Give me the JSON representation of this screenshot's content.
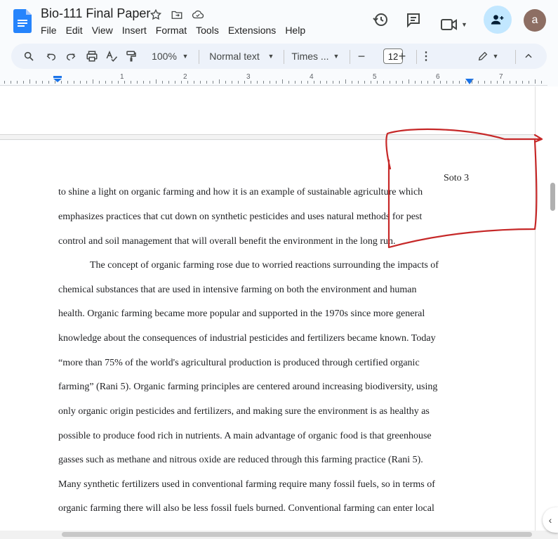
{
  "doc": {
    "title": "Bio-111 Final Paper"
  },
  "menu": [
    "File",
    "Edit",
    "View",
    "Insert",
    "Format",
    "Tools",
    "Extensions",
    "Help"
  ],
  "toolbar": {
    "zoom": "100%",
    "style": "Normal text",
    "font": "Times ...",
    "font_size": "12",
    "minus": "−",
    "plus": "+"
  },
  "avatar": {
    "initial": "a"
  },
  "ruler": [
    "1",
    "2",
    "3",
    "4",
    "5",
    "6",
    "7"
  ],
  "page": {
    "header": "Soto 3",
    "lines": [
      "to shine a light on organic farming and how it is an example of sustainable agriculture which",
      "emphasizes practices that cut down on synthetic pesticides and uses natural methods for pest",
      "control and soil management that will overall benefit the environment in the long run.",
      "The concept of organic farming rose due to worried reactions surrounding the impacts of",
      "chemical substances that are used in intensive farming on both the environment and human",
      "health. Organic farming became more popular and supported in the 1970s since more general",
      "knowledge about the consequences of industrial pesticides and fertilizers became known. Today",
      "“more than 75% of the world's agricultural production is produced through certified organic",
      "farming” (Rani 5). Organic farming principles are centered around increasing biodiversity, using",
      "only organic origin pesticides and fertilizers, and making sure the environment is as healthy as",
      "possible to produce food rich in nutrients. A main advantage of organic food is that greenhouse",
      "gasses such as methane and nitrous oxide are reduced through this farming practice (Rani 5).",
      "Many synthetic fertilizers used in conventional farming require many fossil fuels, so in terms of",
      "organic farming there will also be less fossil fuels burned. Conventional farming can enter local"
    ]
  },
  "colors": {
    "accent": "#1a73e8",
    "share_bg": "#c2e7ff",
    "annotation": "#c62828",
    "avatar": "#8d6e63"
  }
}
